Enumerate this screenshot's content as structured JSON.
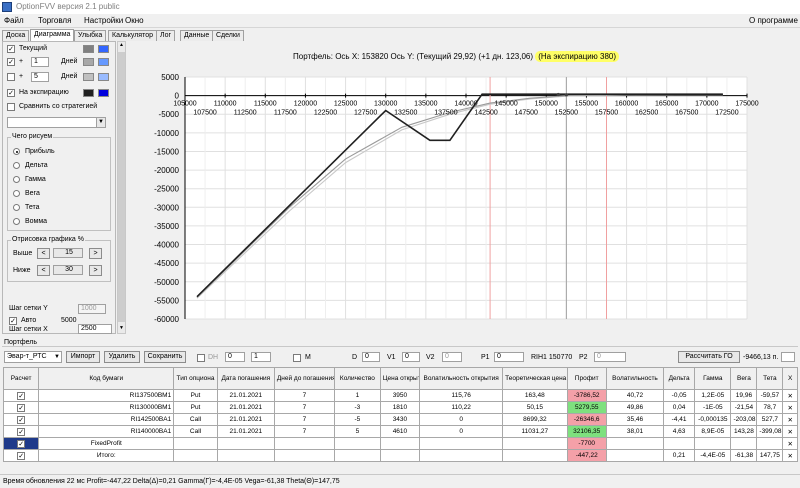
{
  "app": {
    "title": "OptionFVV версия 2.1 public"
  },
  "menu": {
    "items": [
      "Файл",
      "Торговля",
      "Настройки",
      "Окно"
    ],
    "about": "О программе"
  },
  "tabs": [
    "Доска",
    "Диаграмма",
    "Улыбка",
    "Калькулятор",
    "Лог",
    "Данные",
    "Сделки"
  ],
  "tabs_active": 1,
  "left": {
    "current": {
      "label": "Текущий",
      "checked": true,
      "color1": "#808080",
      "color2": "#3366ff"
    },
    "plus1": {
      "sign": "+",
      "value": "1",
      "unit": "Дней",
      "checked": true,
      "color1": "#a8a8a8",
      "color2": "#6699ff"
    },
    "plus2": {
      "sign": "+",
      "value": "5",
      "unit": "Дней",
      "checked": false,
      "color1": "#c0c0c0",
      "color2": "#99bbff"
    },
    "expiry": {
      "label": "На экспирацию",
      "checked": true,
      "color1": "#202020",
      "color2": "#0000dd"
    },
    "compare": {
      "label": "Сравнить со стратегией",
      "checked": false
    },
    "what_to_draw": {
      "title": "Чего рисуем",
      "options": [
        "Прибыль",
        "Дельта",
        "Гамма",
        "Вега",
        "Тета",
        "Вомма"
      ],
      "selected": 0
    },
    "chart_rendering": {
      "title": "Отрисовка графика %",
      "above_label": "Выше",
      "above_value": "15",
      "below_label": "Ниже",
      "below_value": "30",
      "dec": "<",
      "inc": ">"
    },
    "grid_y": {
      "label": "Шаг сетки Y",
      "value": "1000"
    },
    "auto": {
      "label": "Авто",
      "value": "5000",
      "checked": true
    },
    "grid_x": {
      "label": "Шаг сетки X",
      "value": "2500"
    }
  },
  "chart": {
    "header": {
      "p1": "Портфель:",
      "p2": "Ось X:",
      "p3": "153820",
      "p4": "Ось Y:",
      "p5": "(Текущий 29,92)",
      "p6": "(+1 дн. 123,06)",
      "p7": "(На экспирацию 380)"
    },
    "highlight": "#ffff66"
  },
  "chart_data": {
    "type": "line",
    "x_top_ticks": [
      "105000",
      "110000",
      "115000",
      "120000",
      "125000",
      "130000",
      "135000",
      "140000",
      "145000",
      "150000",
      "155000",
      "160000",
      "165000",
      "170000",
      "175000"
    ],
    "x_bottom_ticks": [
      "107500",
      "112500",
      "117500",
      "122500",
      "127500",
      "132500",
      "137500",
      "142500",
      "147500",
      "152500",
      "157500",
      "162500",
      "167500",
      "172500"
    ],
    "y_ticks": [
      "5000",
      "0",
      "-5000",
      "-10000",
      "-15000",
      "-20000",
      "-25000",
      "-30000",
      "-35000",
      "-40000",
      "-45000",
      "-50000",
      "-55000",
      "-60000"
    ],
    "xlim": [
      105000,
      175000
    ],
    "ylim": [
      -60000,
      5000
    ],
    "vlines": [
      {
        "x": 143000,
        "color": "#f0a0a0"
      },
      {
        "x": 152500,
        "color": "#a0a0a0"
      },
      {
        "x": 157500,
        "color": "#f0a0a0"
      }
    ],
    "series": [
      {
        "color": "#202020",
        "points": [
          [
            106500,
            -54000
          ],
          [
            130000,
            -4000
          ],
          [
            135500,
            -12000
          ],
          [
            138000,
            -12000
          ],
          [
            142000,
            380
          ],
          [
            172000,
            380
          ]
        ]
      },
      {
        "color": "#9a9a9a",
        "points": [
          [
            106500,
            -54200
          ],
          [
            118000,
            -30000
          ],
          [
            125000,
            -17000
          ],
          [
            132000,
            -8500
          ],
          [
            138000,
            -4500
          ],
          [
            143000,
            -2000
          ],
          [
            148000,
            -700
          ],
          [
            153000,
            30
          ],
          [
            160000,
            200
          ],
          [
            172000,
            250
          ]
        ]
      },
      {
        "color": "#c8c8c8",
        "points": [
          [
            106500,
            -54400
          ],
          [
            118000,
            -31000
          ],
          [
            125000,
            -18000
          ],
          [
            132000,
            -9200
          ],
          [
            138000,
            -5000
          ],
          [
            143000,
            -2300
          ],
          [
            148000,
            -900
          ],
          [
            153000,
            -50
          ],
          [
            160000,
            150
          ],
          [
            172000,
            220
          ]
        ]
      }
    ],
    "markers": [
      {
        "x": 151500,
        "y": 300
      },
      {
        "x": 152500,
        "y": 200
      }
    ]
  },
  "portfolio": {
    "title": "Портфель",
    "select": "Эвар-т_РТС",
    "import": "Импорт",
    "delete": "Удалить",
    "save": "Сохранить",
    "dh": "DH",
    "spin1": "0",
    "spin2": "1",
    "m": "M",
    "d_label": "D",
    "d_val": "0",
    "v1_label": "V1",
    "v1_val": "0",
    "v2_label": "V2",
    "v2_val": "0",
    "p1_label": "P1",
    "p1_val": "0",
    "ticker": "RIH1 150770",
    "p2_label": "P2",
    "p2_val": "0",
    "calc_go": "Рассчитать ГО",
    "go_value": "-9466,13 п.",
    "columns": [
      "Расчет",
      "Код бумаги",
      "Тип опциона",
      "Дата погашения",
      "Дней до погашения",
      "Количество",
      "Цена открытия",
      "Волатильность открытия",
      "Теоретическая цена",
      "Профит",
      "Волатильность",
      "Дельта",
      "Гамма",
      "Вега",
      "Тета",
      "X"
    ],
    "rows": [
      {
        "code": "RI137500BM1",
        "type": "Put",
        "date": "21.01.2021",
        "days": "7",
        "qty": "1",
        "price": "3950",
        "vol": "115,76",
        "theo": "163,48",
        "profit": "-3786,52",
        "pclass": "neg",
        "curvol": "40,72",
        "delta": "-0,05",
        "gamma": "1,2E-05",
        "vega": "19,96",
        "theta": "-59,57",
        "x": "✕"
      },
      {
        "code": "RI130000BM1",
        "type": "Put",
        "date": "21.01.2021",
        "days": "7",
        "qty": "-3",
        "price": "1810",
        "vol": "110,22",
        "theo": "50,15",
        "profit": "5279,55",
        "pclass": "pos",
        "curvol": "49,86",
        "delta": "0,04",
        "gamma": "-1E-05",
        "vega": "-21,54",
        "theta": "78,7",
        "x": "✕"
      },
      {
        "code": "RI142500BA1",
        "type": "Call",
        "date": "21.01.2021",
        "days": "7",
        "qty": "-5",
        "price": "3430",
        "vol": "0",
        "theo": "8699,32",
        "profit": "-26346,6",
        "pclass": "neg",
        "curvol": "35,46",
        "delta": "-4,41",
        "gamma": "-0,000135",
        "vega": "-203,08",
        "theta": "527,7",
        "x": "✕"
      },
      {
        "code": "RI140000BA1",
        "type": "Call",
        "date": "21.01.2021",
        "days": "7",
        "qty": "5",
        "price": "4610",
        "vol": "0",
        "theo": "11031,27",
        "profit": "32106,35",
        "pclass": "pos",
        "curvol": "38,01",
        "delta": "4,63",
        "gamma": "8,9E-05",
        "vega": "143,28",
        "theta": "-399,08",
        "x": "✕"
      }
    ],
    "fixed": {
      "label": "FixedProfit",
      "profit": "-7700",
      "x": "✕"
    },
    "total": {
      "label": "Итого:",
      "profit": "-447,22",
      "delta": "0,21",
      "gamma": "-4,4E-05",
      "vega": "-61,38",
      "theta": "147,75",
      "x": "✕"
    }
  },
  "status": "Время обновления 22 мс  Profit=-447,22 Delta(Δ)=0,21 Gamma(Γ)=-4,4E-05 Vega=-61,38 Theta(Θ)=147,75"
}
